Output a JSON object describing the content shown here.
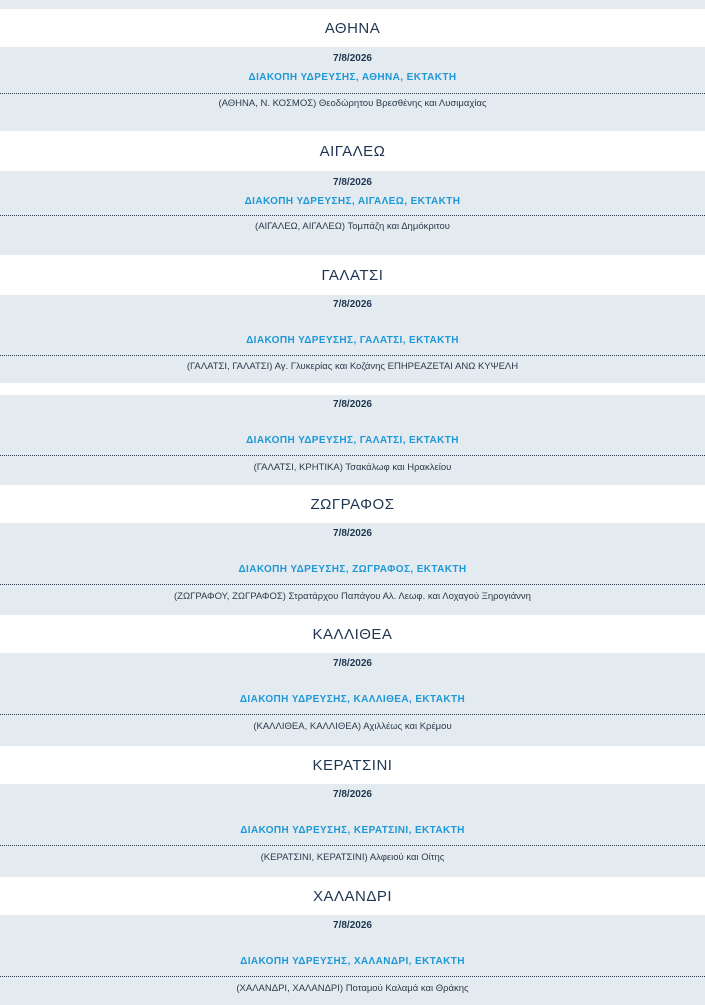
{
  "areas": [
    {
      "name": "ΑΘΗΝΑ",
      "items": [
        {
          "date": "7/8/2026",
          "title": "ΔΙΑΚΟΠΗ ΥΔΡΕΥΣΗΣ, ΑΘΗΝΑ, ΕΚΤΑΚΤΗ",
          "address": "(ΑΘΗΝΑ, Ν. ΚΟΣΜΟΣ) Θεοδώρητου Βρεσθένης και Λυσιμαχίας"
        }
      ]
    },
    {
      "name": "ΑΙΓΑΛΕΩ",
      "items": [
        {
          "date": "7/8/2026",
          "title": "ΔΙΑΚΟΠΗ ΥΔΡΕΥΣΗΣ, ΑΙΓΑΛΕΩ, ΕΚΤΑΚΤΗ",
          "address": "(ΑΙΓΑΛΕΩ, ΑΙΓΑΛΕΩ) Τομπάζη και Δημόκριτου"
        }
      ]
    },
    {
      "name": "ΓΑΛΑΤΣΙ",
      "items": [
        {
          "date": "7/8/2026",
          "title": "ΔΙΑΚΟΠΗ ΥΔΡΕΥΣΗΣ, ΓΑΛΑΤΣΙ, ΕΚΤΑΚΤΗ",
          "address": "(ΓΑΛΑΤΣΙ, ΓΑΛΑΤΣΙ) Αγ. Γλυκερίας και Κοζάνης ΕΠΗΡΕΑΖΕΤΑΙ ΑΝΩ ΚΥΨΕΛΗ"
        },
        {
          "date": "7/8/2026",
          "title": "ΔΙΑΚΟΠΗ ΥΔΡΕΥΣΗΣ, ΓΑΛΑΤΣΙ, ΕΚΤΑΚΤΗ",
          "address": "(ΓΑΛΑΤΣΙ, ΚΡΗΤΙΚΑ) Τσακάλωφ και Ηρακλείου"
        }
      ]
    },
    {
      "name": "ΖΩΓΡΑΦΟΣ",
      "items": [
        {
          "date": "7/8/2026",
          "title": "ΔΙΑΚΟΠΗ ΥΔΡΕΥΣΗΣ, ΖΩΓΡΑΦΟΣ, ΕΚΤΑΚΤΗ",
          "address": "(ΖΩΓΡΑΦΟΥ, ΖΩΓΡΑΦΟΣ) Στρατάρχου Παπάγου Αλ. Λεωφ. και Λοχαγού Ξηρογιάννη"
        }
      ]
    },
    {
      "name": "ΚΑΛΛΙΘΕΑ",
      "items": [
        {
          "date": "7/8/2026",
          "title": "ΔΙΑΚΟΠΗ ΥΔΡΕΥΣΗΣ, ΚΑΛΛΙΘΕΑ, ΕΚΤΑΚΤΗ",
          "address": "(ΚΑΛΛΙΘΕΑ, ΚΑΛΛΙΘΕΑ) Αχιλλέως και Κρέμου"
        }
      ]
    },
    {
      "name": "ΚΕΡΑΤΣΙΝΙ",
      "items": [
        {
          "date": "7/8/2026",
          "title": "ΔΙΑΚΟΠΗ ΥΔΡΕΥΣΗΣ, ΚΕΡΑΤΣΙΝΙ, ΕΚΤΑΚΤΗ",
          "address": "(ΚΕΡΑΤΣΙΝΙ, ΚΕΡΑΤΣΙΝΙ) Αλφειού και Οίτης"
        }
      ]
    },
    {
      "name": "ΧΑΛΑΝΔΡΙ",
      "items": [
        {
          "date": "7/8/2026",
          "title": "ΔΙΑΚΟΠΗ ΥΔΡΕΥΣΗΣ, ΧΑΛΑΝΔΡΙ, ΕΚΤΑΚΤΗ",
          "address": "(ΧΑΛΑΝΔΡΙ, ΧΑΛΑΝΔΡΙ) Ποταμού Καλαμά και Θράκης"
        }
      ]
    }
  ]
}
